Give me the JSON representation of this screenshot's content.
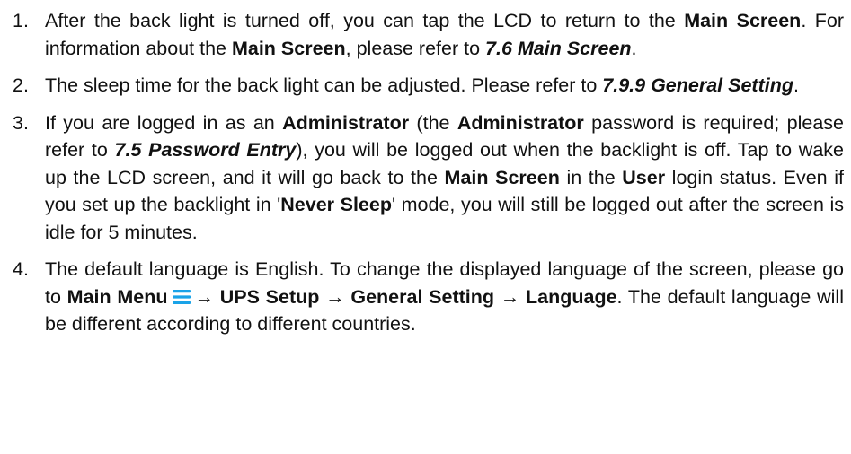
{
  "items": [
    {
      "number": "1.",
      "segments": [
        {
          "text": "After the back light is turned off, you can tap the LCD to return to the ",
          "style": "normal"
        },
        {
          "text": "Main Screen",
          "style": "bold"
        },
        {
          "text": ". For information about the ",
          "style": "normal"
        },
        {
          "text": "Main Screen",
          "style": "bold"
        },
        {
          "text": ", please refer to ",
          "style": "normal"
        },
        {
          "text": "7.6 Main Screen",
          "style": "ref"
        },
        {
          "text": ".",
          "style": "normal"
        }
      ]
    },
    {
      "number": "2.",
      "segments": [
        {
          "text": "The sleep time for the back light can be adjusted. Please refer to ",
          "style": "normal"
        },
        {
          "text": "7.9.9 General Setting",
          "style": "ref"
        },
        {
          "text": ".",
          "style": "normal"
        }
      ]
    },
    {
      "number": "3.",
      "segments": [
        {
          "text": "If you are logged in as an ",
          "style": "normal"
        },
        {
          "text": "Administrator",
          "style": "bold"
        },
        {
          "text": " (the ",
          "style": "normal"
        },
        {
          "text": "Administrator",
          "style": "bold"
        },
        {
          "text": " password is required; please refer to ",
          "style": "normal"
        },
        {
          "text": "7.5 Password Entry",
          "style": "ref"
        },
        {
          "text": "), you will be logged out when the backlight is off. Tap to wake up the LCD screen, and it will go back to the ",
          "style": "normal"
        },
        {
          "text": "Main Screen",
          "style": "bold"
        },
        {
          "text": " in the ",
          "style": "normal"
        },
        {
          "text": "User",
          "style": "bold"
        },
        {
          "text": " login status. Even if you set up the backlight in '",
          "style": "normal"
        },
        {
          "text": "Never Sleep",
          "style": "bold"
        },
        {
          "text": "' mode, you will still be logged out after the screen is idle for 5 minutes.",
          "style": "normal"
        }
      ]
    },
    {
      "number": "4.",
      "segments": [
        {
          "text": "The default language is English. To change the displayed language of the screen, please go to ",
          "style": "normal"
        },
        {
          "text": "Main Menu",
          "style": "bold"
        },
        {
          "text": "",
          "style": "icon",
          "icon": "main-menu-icon"
        },
        {
          "text": "→ UPS Setup → General Setting → Language",
          "style": "bold"
        },
        {
          "text": ". The default language will be different according to different countries.",
          "style": "normal"
        }
      ]
    }
  ],
  "colors": {
    "text": "#111111",
    "menu_icon": "#1aa3e8"
  }
}
